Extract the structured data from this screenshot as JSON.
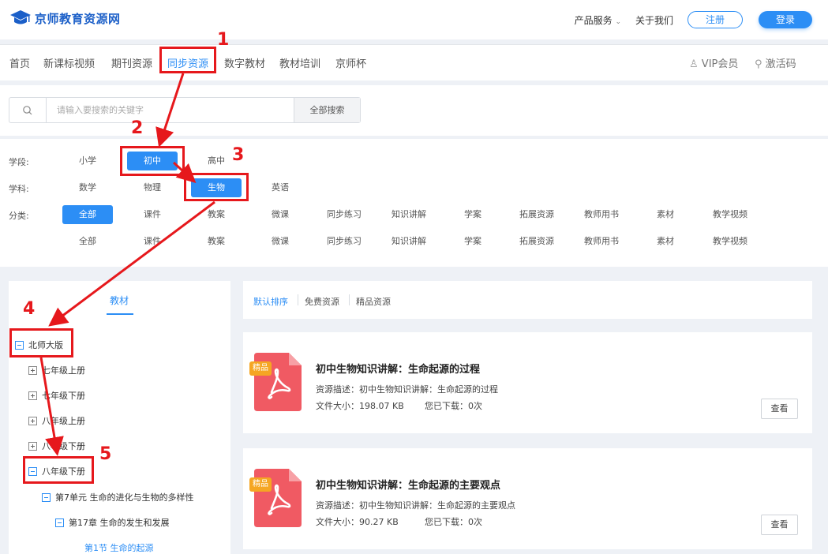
{
  "header": {
    "logo_text": "京师教育资源网",
    "links": [
      "产品服务",
      "关于我们"
    ],
    "register": "注册",
    "login": "登录"
  },
  "nav": {
    "items": [
      "首页",
      "新课标视频",
      "期刊资源",
      "同步资源",
      "数字教材",
      "教材培训",
      "京师杯"
    ],
    "active": "同步资源",
    "vip": "VIP会员",
    "activation": "激活码"
  },
  "search": {
    "placeholder": "请输入要搜索的关键字",
    "button": "全部搜索"
  },
  "filters": {
    "stage_label": "学段:",
    "stages": [
      "小学",
      "初中",
      "高中"
    ],
    "subject_label": "学科:",
    "subjects": [
      "数学",
      "物理",
      "生物",
      "英语"
    ],
    "category_label": "分类:",
    "categories": [
      "全部",
      "课件",
      "教案",
      "微课",
      "同步练习",
      "知识讲解",
      "学案",
      "拓展资源",
      "教师用书",
      "素材",
      "教学视频"
    ],
    "categories2": [
      "全部",
      "课件",
      "教案",
      "微课",
      "同步练习",
      "知识讲解",
      "学案",
      "拓展资源",
      "教师用书",
      "素材",
      "教学视频"
    ]
  },
  "sidebar": {
    "tab": "教材",
    "tree": [
      "北师大版",
      "七年级上册",
      "七年级下册",
      "八年级上册",
      "八年级下册",
      "八年级下册",
      "第7单元 生命的进化与生物的多样性",
      "第17章 生命的发生和发展",
      "第1节 生命的起源"
    ]
  },
  "sort": {
    "items": [
      "默认排序",
      "免费资源",
      "精品资源"
    ]
  },
  "cards": [
    {
      "badge": "精品",
      "title": "初中生物知识讲解：生命起源的过程",
      "desc": "资源描述：初中生物知识讲解：生命起源的过程",
      "size": "文件大小：198.07 KB",
      "downloads": "您已下载：0次",
      "view": "查看"
    },
    {
      "badge": "精品",
      "title": "初中生物知识讲解：生命起源的主要观点",
      "desc": "资源描述：初中生物知识讲解：生命起源的主要观点",
      "size": "文件大小：90.27 KB",
      "downloads": "您已下载：0次",
      "view": "查看"
    }
  ],
  "annotations": [
    "1",
    "2",
    "3",
    "4",
    "5"
  ],
  "colors": {
    "accent": "#2c8ef5",
    "annotation": "#e6181c",
    "badge": "#f5a623",
    "pdf": "#f05a63"
  }
}
